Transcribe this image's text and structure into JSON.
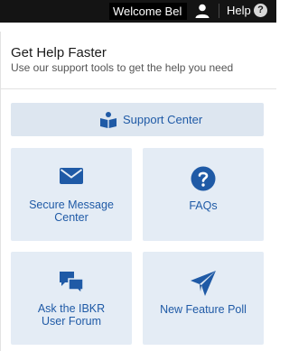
{
  "topbar": {
    "welcome_text": "Welcome Bel",
    "help_label": "Help",
    "help_icon_glyph": "?"
  },
  "panel": {
    "title": "Get Help Faster",
    "subtitle": "Use our support tools to get the help you need"
  },
  "support_center": {
    "label": "Support Center",
    "icon": "reader-icon"
  },
  "tiles": [
    {
      "label_line1": "Secure Message",
      "label_line2": "Center",
      "icon": "envelope-icon"
    },
    {
      "label_line1": "FAQs",
      "label_line2": "",
      "icon": "question-circle-icon"
    },
    {
      "label_line1": "Ask the IBKR",
      "label_line2": "User Forum",
      "icon": "chat-bubbles-icon"
    },
    {
      "label_line1": "New Feature Poll",
      "label_line2": "",
      "icon": "paper-plane-icon"
    }
  ],
  "colors": {
    "accent": "#1f5aa6",
    "tile_bg": "#e4ecf5",
    "topbar_bg": "#141414"
  }
}
